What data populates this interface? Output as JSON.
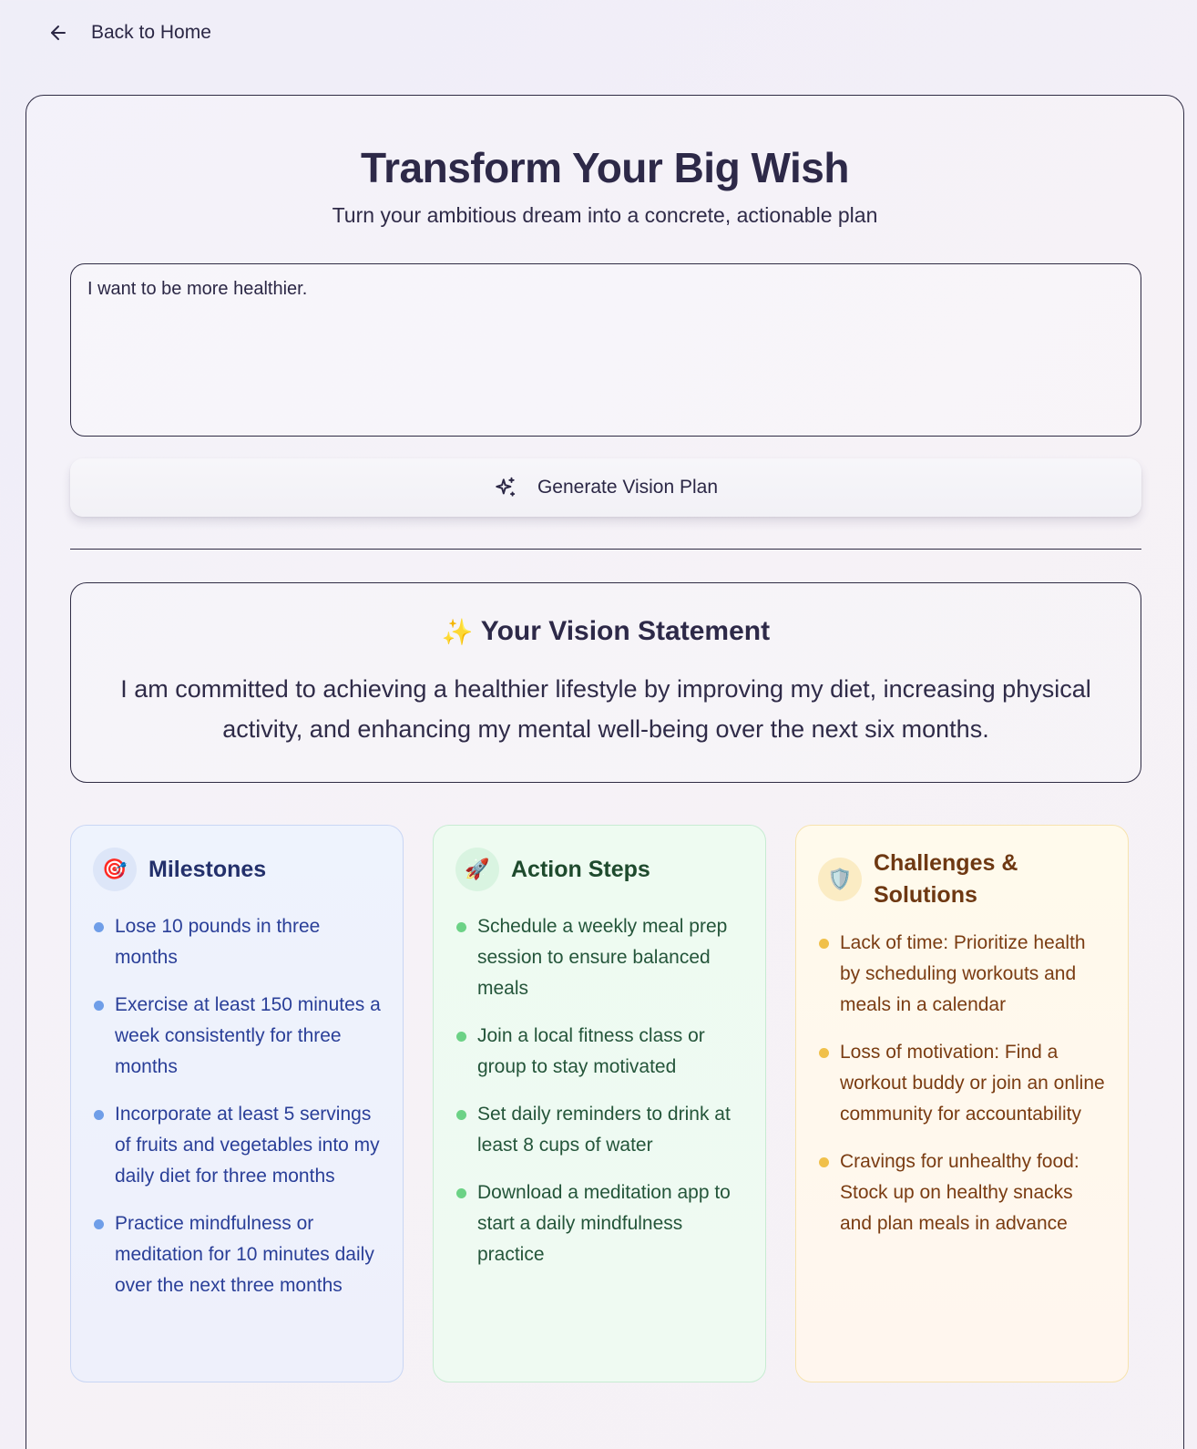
{
  "nav": {
    "back_label": "Back to Home",
    "back_icon": "arrow-left-icon"
  },
  "header": {
    "title": "Transform Your Big Wish",
    "subtitle": "Turn your ambitious dream into a concrete, actionable plan"
  },
  "wish_input": {
    "value": "I want to be more healthier.",
    "placeholder": ""
  },
  "generate_button": {
    "label": "Generate Vision Plan",
    "icon": "sparkles-icon"
  },
  "vision": {
    "emoji": "✨",
    "title": "Your Vision Statement",
    "text": "I am committed to achieving a healthier lifestyle by improving my diet, increasing physical activity, and enhancing my mental well-being over the next six months."
  },
  "milestones": {
    "emoji": "🎯",
    "title": "Milestones",
    "items": [
      "Lose 10 pounds in three months",
      "Exercise at least 150 minutes a week consistently for three months",
      "Incorporate at least 5 servings of fruits and vegetables into my daily diet for three months",
      "Practice mindfulness or meditation for 10 minutes daily over the next three months"
    ]
  },
  "action_steps": {
    "emoji": "🚀",
    "title": "Action Steps",
    "items": [
      "Schedule a weekly meal prep session to ensure balanced meals",
      "Join a local fitness class or group to stay motivated",
      "Set daily reminders to drink at least 8 cups of water",
      "Download a meditation app to start a daily mindfulness practice"
    ]
  },
  "challenges": {
    "emoji": "🛡️",
    "title": "Challenges & Solutions",
    "items": [
      "Lack of time: Prioritize health by scheduling workouts and meals in a calendar",
      "Loss of motivation: Find a workout buddy or join an online community for accountability",
      "Cravings for unhealthy food: Stock up on healthy snacks and plan meals in advance"
    ]
  },
  "colors": {
    "milestones_accent": "#6f9ee8",
    "action_steps_accent": "#6cd286",
    "challenges_accent": "#f0c04a",
    "text_dark": "#2d2948"
  }
}
